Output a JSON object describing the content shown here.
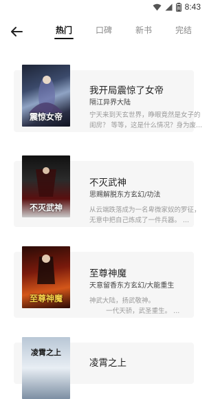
{
  "status": {
    "time": "8:43",
    "battery": "8"
  },
  "tabs": [
    {
      "label": "热门"
    },
    {
      "label": "口碑"
    },
    {
      "label": "新书"
    },
    {
      "label": "完结"
    }
  ],
  "books": [
    {
      "title": "我开局震惊了女帝",
      "meta": "隔江异界大陆",
      "desc_lines": [
        "宁天来到天玄世界，睁眼竟然是女子的",
        "闺房？ 等等，这是什么情况？身为废..."
      ],
      "cover_text": "震惊女帝"
    },
    {
      "title": "不灭武神",
      "meta": "思赐解脱东方玄幻/功法",
      "desc_lines": [
        "从云端跌落成为一名卑微家奴的罗征，",
        "无意中把自己炼成了一件兵器。 ..."
      ],
      "cover_text": "不灭武神"
    },
    {
      "title": "至尊神魔",
      "meta": "天意留香东方玄幻/大能重生",
      "desc_lines": [
        "神武大陆，扬武敬神。",
        "        一代天骄，武圣重生。 ..."
      ],
      "cover_text": "至尊神魔"
    },
    {
      "title": "凌霄之上",
      "meta": "",
      "desc_lines": [],
      "cover_text": "凌霄之上"
    }
  ],
  "colors": {
    "active_tab": "#111111",
    "inactive_tab": "#8a8a8a",
    "card_bg": "#f6f6f6"
  }
}
